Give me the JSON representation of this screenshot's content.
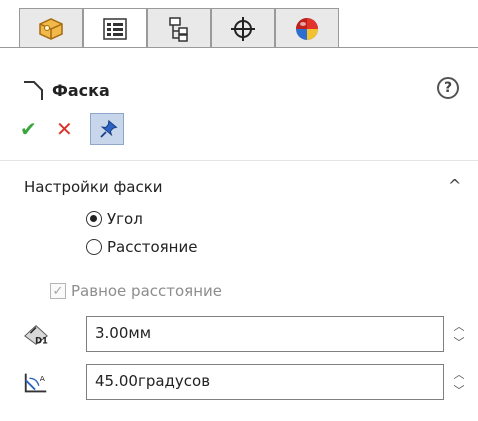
{
  "tabs": [
    {
      "icon": "feature-manager-icon",
      "active": false
    },
    {
      "icon": "property-manager-icon",
      "active": true
    },
    {
      "icon": "configuration-manager-icon",
      "active": false
    },
    {
      "icon": "dimxpert-manager-icon",
      "active": false
    },
    {
      "icon": "display-manager-icon",
      "active": false
    }
  ],
  "header": {
    "title": "Фаска",
    "help_label": "?",
    "feature_icon": "chamfer-icon"
  },
  "actions": {
    "ok_label": "✔",
    "cancel_label": "✕",
    "pin_icon": "pushpin-icon"
  },
  "section": {
    "title": "Настройки фаски",
    "collapse_icon": "chevron-up-icon",
    "collapse_label": "^",
    "radios": [
      {
        "label": "Угол",
        "selected": true
      },
      {
        "label": "Расстояние",
        "selected": false
      }
    ],
    "equal_distance": {
      "label": "Равное расстояние",
      "checked": true,
      "enabled": false
    },
    "distance_field": {
      "icon": "distance-d1-icon",
      "value": "3.00мм"
    },
    "angle_field": {
      "icon": "angle-icon",
      "value": "45.00градусов"
    }
  },
  "colors": {
    "accent": "#c7d6ea",
    "ok": "#3aa53a",
    "cancel": "#d9342b"
  }
}
